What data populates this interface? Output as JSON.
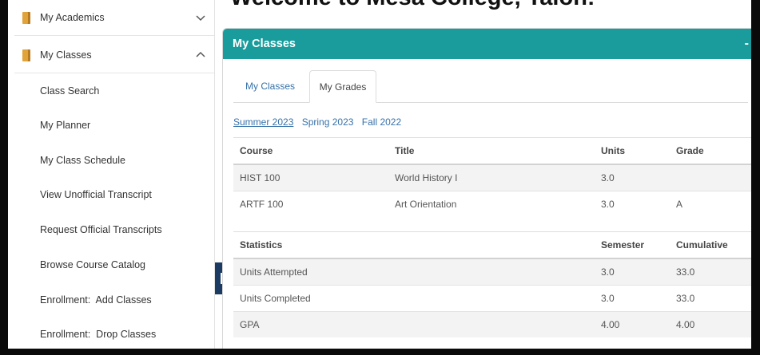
{
  "welcome_text": "Welcome to Mesa College, Talon!",
  "sidebar": {
    "sections": [
      {
        "label": "My Academics",
        "expanded": false,
        "icon": "book-icon"
      },
      {
        "label": "My Classes",
        "expanded": true,
        "icon": "book-icon"
      }
    ],
    "items": [
      {
        "label": "Class Search"
      },
      {
        "label": "My Planner"
      },
      {
        "label": "My Class Schedule"
      },
      {
        "label": "View Unofficial Transcript"
      },
      {
        "label": "Request Official Transcripts"
      },
      {
        "label": "Browse Course Catalog"
      },
      {
        "label": "Enrollment:  Add Classes"
      },
      {
        "label": "Enrollment:  Drop Classes"
      }
    ]
  },
  "panel": {
    "title": "My Classes",
    "collapse_symbol": "-",
    "tabs": [
      {
        "label": "My Classes",
        "active": false
      },
      {
        "label": "My Grades",
        "active": true
      }
    ],
    "terms": [
      "Summer 2023",
      "Spring 2023",
      "Fall 2022"
    ],
    "selected_term": "Summer 2023",
    "grades_table": {
      "headers": [
        "Course",
        "Title",
        "Units",
        "Grade"
      ],
      "rows": [
        [
          "HIST 100",
          "World History I",
          "3.0",
          ""
        ],
        [
          "ARTF 100",
          "Art Orientation",
          "3.0",
          "A"
        ]
      ]
    },
    "stats_table": {
      "headers": [
        "Statistics",
        "",
        "Semester",
        "Cumulative"
      ],
      "rows": [
        [
          "Units Attempted",
          "",
          "3.0",
          "33.0"
        ],
        [
          "Units Completed",
          "",
          "3.0",
          "33.0"
        ],
        [
          "GPA",
          "",
          "4.00",
          "4.00"
        ]
      ]
    }
  },
  "colors": {
    "header_teal": "#1a9c9c",
    "link_blue": "#3571a9",
    "handle_navy": "#1c3b62",
    "book_orange": "#e0a43a"
  }
}
